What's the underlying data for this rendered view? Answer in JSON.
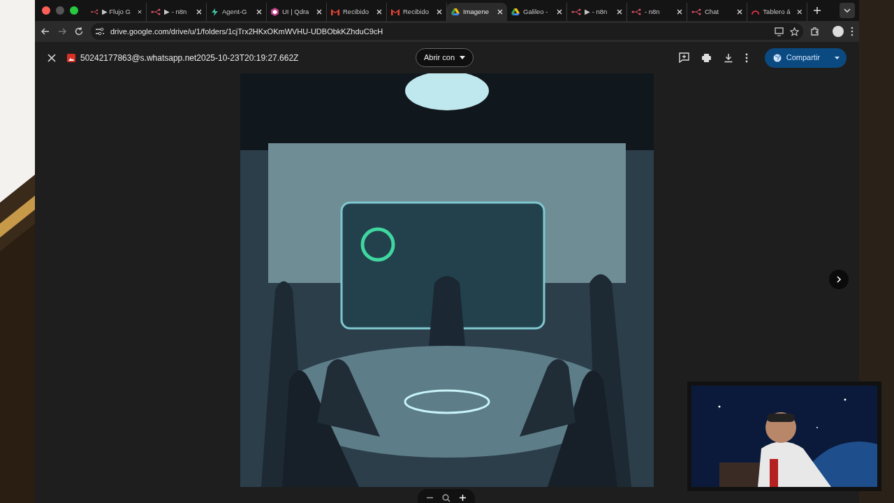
{
  "tabs": [
    {
      "title": "▶ Flujo G",
      "kind": "n8n",
      "selected": false
    },
    {
      "title": "▶ - n8n",
      "kind": "n8n",
      "selected": false
    },
    {
      "title": "Agent-G",
      "kind": "agent",
      "selected": false
    },
    {
      "title": "UI | Qdra",
      "kind": "cube",
      "selected": false
    },
    {
      "title": "Recibido",
      "kind": "mail",
      "selected": false
    },
    {
      "title": "Recibido",
      "kind": "mail",
      "selected": false
    },
    {
      "title": "Imagene",
      "kind": "drive",
      "selected": true
    },
    {
      "title": "Galileo -",
      "kind": "drive",
      "selected": false
    },
    {
      "title": "▶ - n8n",
      "kind": "n8n",
      "selected": false
    },
    {
      "title": "- n8n",
      "kind": "n8n",
      "selected": false
    },
    {
      "title": "Chat",
      "kind": "n8n",
      "selected": false
    },
    {
      "title": "Tablero á",
      "kind": "arc",
      "selected": false
    }
  ],
  "address_bar": {
    "url": "drive.google.com/drive/u/1/folders/1cjTrx2HKxOKmWVHU-UDBObkKZhduC9cH"
  },
  "viewer": {
    "file_name": "50242177863@s.whatsapp.net2025-10-23T20:19:27.662Z",
    "open_with": "Abrir con",
    "share": "Compartir"
  }
}
